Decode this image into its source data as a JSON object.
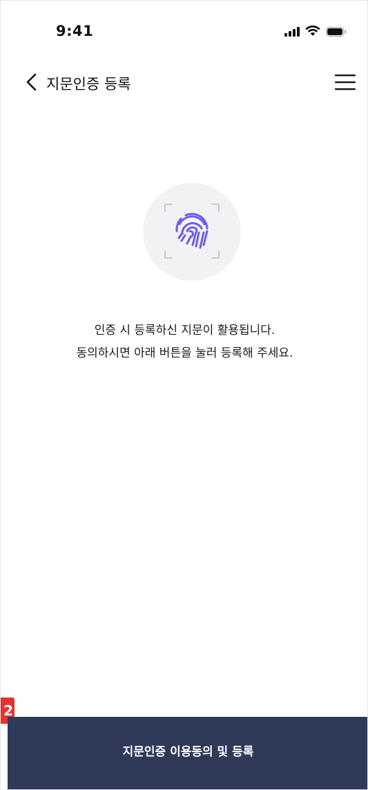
{
  "status_bar": {
    "time": "9:41",
    "signal_icon": "cellular-signal-icon",
    "wifi_icon": "wifi-icon",
    "battery_icon": "battery-icon"
  },
  "header": {
    "back_icon": "chevron-left-icon",
    "title": "지문인증 등록",
    "menu_icon": "hamburger-menu-icon"
  },
  "main": {
    "fingerprint_icon": "fingerprint-icon",
    "fingerprint_color": "#6b5cf0",
    "message_line1": "인증 시 등록하신 지문이 활용됩니다.",
    "message_line2": "동의하시면 아래 버튼을 눌러 등록해 주세요."
  },
  "marker": {
    "label": "2",
    "color": "#e5332a"
  },
  "footer": {
    "button_label": "지문인증 이용동의 및 등록",
    "button_color": "#2f3a58"
  }
}
